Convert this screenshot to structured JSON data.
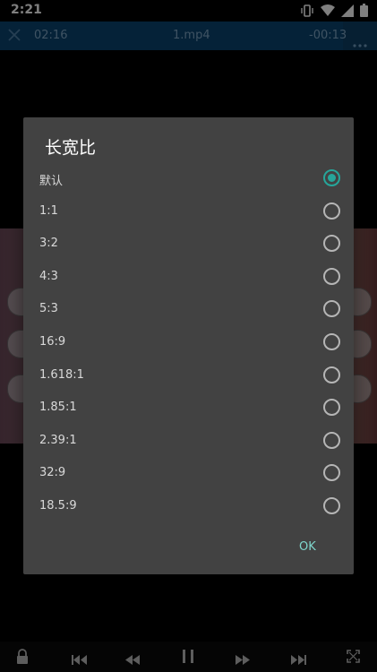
{
  "status_bar": {
    "time": "2:21",
    "icons": [
      "vibrate-icon",
      "wifi-icon",
      "signal-icon",
      "battery-icon"
    ]
  },
  "player": {
    "elapsed": "02:16",
    "title": "1.mp4",
    "remaining": "-00:13",
    "progress_fraction": 0.91,
    "accent_color": "#0b4470"
  },
  "dialog": {
    "title": "长宽比",
    "options": [
      "默认",
      "1:1",
      "3:2",
      "4:3",
      "5:3",
      "16:9",
      "1.618:1",
      "1.85:1",
      "2.39:1",
      "32:9",
      "18.5:9"
    ],
    "selected_index": 0,
    "ok_label": "OK",
    "accent_color": "#26a69a"
  },
  "bottom_controls": [
    "lock-icon",
    "skip-previous-icon",
    "rewind-icon",
    "pause-icon",
    "fast-forward-icon",
    "skip-next-icon",
    "fullscreen-icon"
  ]
}
